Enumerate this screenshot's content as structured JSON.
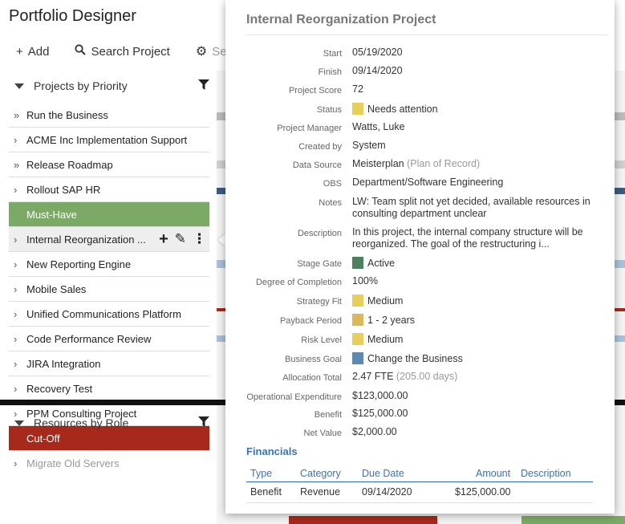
{
  "app": {
    "title": "Portfolio Designer"
  },
  "toolbar": {
    "add_label": "Add",
    "search_label": "Search Project",
    "settings_label": "Settings"
  },
  "sidebar": {
    "projects_header": "Projects by Priority",
    "resources_header": "Resources by Role",
    "items": [
      {
        "label": "Run the Business",
        "chev": "»",
        "kind": "item"
      },
      {
        "label": "ACME Inc Implementation Support",
        "chev": "›",
        "kind": "item"
      },
      {
        "label": "Release Roadmap",
        "chev": "»",
        "kind": "item"
      },
      {
        "label": "Rollout SAP HR",
        "chev": "›",
        "kind": "item"
      },
      {
        "label": "Must-Have",
        "chev": "",
        "kind": "group-green"
      },
      {
        "label": "Internal Reorganization ...",
        "chev": "›",
        "kind": "selected"
      },
      {
        "label": "New Reporting Engine",
        "chev": "›",
        "kind": "item"
      },
      {
        "label": "Mobile Sales",
        "chev": "›",
        "kind": "item"
      },
      {
        "label": "Unified Communications Platform",
        "chev": "›",
        "kind": "item"
      },
      {
        "label": "Code Performance Review",
        "chev": "›",
        "kind": "item"
      },
      {
        "label": "JIRA Integration",
        "chev": "›",
        "kind": "item"
      },
      {
        "label": "Recovery Test",
        "chev": "›",
        "kind": "item"
      },
      {
        "label": "PPM Consulting Project",
        "chev": "›",
        "kind": "item"
      },
      {
        "label": "Cut-Off",
        "chev": "",
        "kind": "group-red"
      },
      {
        "label": "Migrate Old Servers",
        "chev": "›",
        "kind": "faded"
      }
    ]
  },
  "popup": {
    "title": "Internal Reorganization Project",
    "fields": [
      {
        "label": "Start",
        "value": "05/19/2020"
      },
      {
        "label": "Finish",
        "value": "09/14/2020"
      },
      {
        "label": "Project Score",
        "value": "72"
      },
      {
        "label": "Status",
        "value": "Needs attention",
        "swatch": "#e8cf5a"
      },
      {
        "label": "Project Manager",
        "value": "Watts, Luke"
      },
      {
        "label": "Created by",
        "value": "System"
      },
      {
        "label": "Data Source",
        "value": "Meisterplan",
        "muted": "(Plan of Record)"
      },
      {
        "label": "OBS",
        "value": "Department/Software Engineering"
      },
      {
        "label": "Notes",
        "value": "LW: Team split not yet decided, available resources in consulting department unclear"
      },
      {
        "label": "Description",
        "value": "In this project, the internal company structure will be reorganized. The goal of the restructuring i..."
      },
      {
        "label": "Stage Gate",
        "value": "Active",
        "swatch": "#4e7f5e"
      },
      {
        "label": "Degree of Completion",
        "value": "100%"
      },
      {
        "label": "Strategy Fit",
        "value": "Medium",
        "swatch": "#e8cf5a"
      },
      {
        "label": "Payback Period",
        "value": "1 - 2 years",
        "swatch": "#ddb85a"
      },
      {
        "label": "Risk Level",
        "value": "Medium",
        "swatch": "#e8cf5a"
      },
      {
        "label": "Business Goal",
        "value": "Change the Business",
        "swatch": "#5b89b5"
      },
      {
        "label": "Allocation Total",
        "value": "2.47 FTE",
        "muted": "(205.00 days)"
      },
      {
        "label": "Operational Expenditure",
        "value": "$123,000.00"
      },
      {
        "label": "Benefit",
        "value": "$125,000.00"
      },
      {
        "label": "Net Value",
        "value": "$2,000.00"
      }
    ],
    "financials": {
      "title": "Financials",
      "headers": {
        "type": "Type",
        "category": "Category",
        "due_date": "Due Date",
        "amount": "Amount",
        "description": "Description"
      },
      "row": {
        "type": "Benefit",
        "category": "Revenue",
        "due_date": "09/14/2020",
        "amount": "$125,000.00",
        "description": ""
      }
    }
  }
}
